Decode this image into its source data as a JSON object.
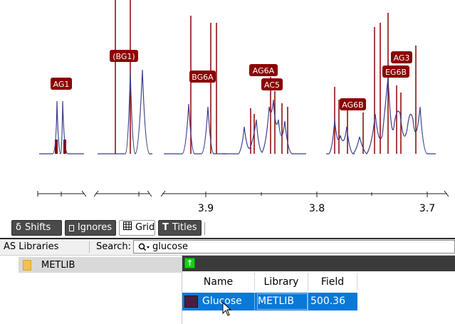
{
  "spectrum": {
    "xticks": [
      "3.9",
      "3.8",
      "3.7"
    ],
    "labels": {
      "ag1": "AG1",
      "bg1": "(BG1)",
      "bg6a": "BG6A",
      "ag6a": "AG6A",
      "ac5": "AC5",
      "ag6b": "AG6B",
      "eg6b": "EG6B",
      "ag3": "AG3"
    },
    "colors": {
      "spectrum_line": "#3a3f8c",
      "peak_bar": "#8b0000",
      "label_bg": "#8b0000"
    }
  },
  "toolbar": {
    "shifts_icon": "δ",
    "shifts_label": "Shifts",
    "ignores_label": "Ignores",
    "grid_label": "Grid",
    "titles_label": "Titles"
  },
  "libraries": {
    "title": "AS Libraries",
    "search_label": "Search:",
    "search_value": "glucose",
    "tree_item": "METLIB"
  },
  "table": {
    "headers": [
      "Name",
      "Library",
      "Field"
    ],
    "rows": [
      {
        "name": "Glucose",
        "library": "METLIB",
        "field": "500.36",
        "color": "#4a1e40"
      }
    ]
  }
}
